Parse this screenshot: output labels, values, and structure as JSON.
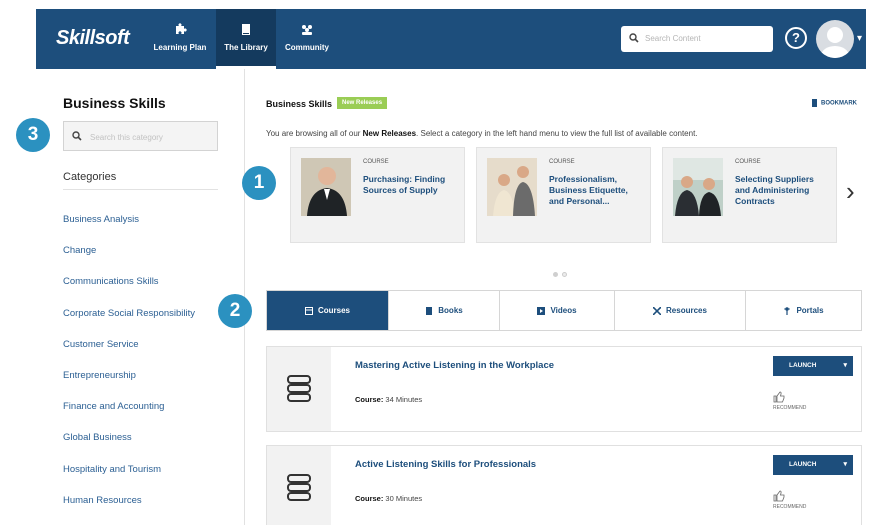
{
  "header": {
    "logo": "Skillsoft",
    "nav": [
      {
        "label": "Learning Plan",
        "icon": "puzzle-icon"
      },
      {
        "label": "The Library",
        "icon": "book-icon"
      },
      {
        "label": "Community",
        "icon": "people-icon"
      }
    ],
    "search_placeholder": "Search Content",
    "help_glyph": "?",
    "caret": "▾"
  },
  "sidebar": {
    "title": "Business Skills",
    "search_placeholder": "Search this category",
    "categories_label": "Categories",
    "categories": [
      "Business Analysis",
      "Change",
      "Communications Skills",
      "Corporate Social Responsibility",
      "Customer Service",
      "Entrepreneurship",
      "Finance and Accounting",
      "Global Business",
      "Hospitality and Tourism",
      "Human Resources"
    ]
  },
  "badges": [
    "1",
    "2",
    "3"
  ],
  "main": {
    "title": "Business Skills",
    "tag": "New Releases",
    "bookmark": "BOOKMARK",
    "browse_prefix": "You are browsing all of our ",
    "browse_bold": "New Releases",
    "browse_suffix": ". Select a category in the left hand menu to view the full list of available content.",
    "carousel": [
      {
        "type": "COURSE",
        "title": "Purchasing: Finding Sources of Supply"
      },
      {
        "type": "COURSE",
        "title": "Professionalism, Business Etiquette, and Personal..."
      },
      {
        "type": "COURSE",
        "title": "Selecting Suppliers and Administering Contracts"
      }
    ],
    "next_glyph": "›",
    "tabs": [
      {
        "label": "Courses",
        "icon": "course-icon",
        "active": true
      },
      {
        "label": "Books",
        "icon": "book-icon"
      },
      {
        "label": "Videos",
        "icon": "video-icon"
      },
      {
        "label": "Resources",
        "icon": "tools-icon"
      },
      {
        "label": "Portals",
        "icon": "portal-icon"
      }
    ],
    "courses": [
      {
        "title": "Mastering Active Listening in the Workplace",
        "meta_label": "Course:",
        "meta_value": " 34 Minutes",
        "launch": "LAUNCH",
        "recommend": "RECOMMEND"
      },
      {
        "title": "Active Listening Skills for Professionals",
        "meta_label": "Course:",
        "meta_value": " 30 Minutes",
        "launch": "LAUNCH",
        "recommend": "RECOMMEND"
      }
    ]
  },
  "colors": {
    "brand": "#1d4e7c",
    "badge": "#2b91c0",
    "tag": "#9acd55"
  }
}
